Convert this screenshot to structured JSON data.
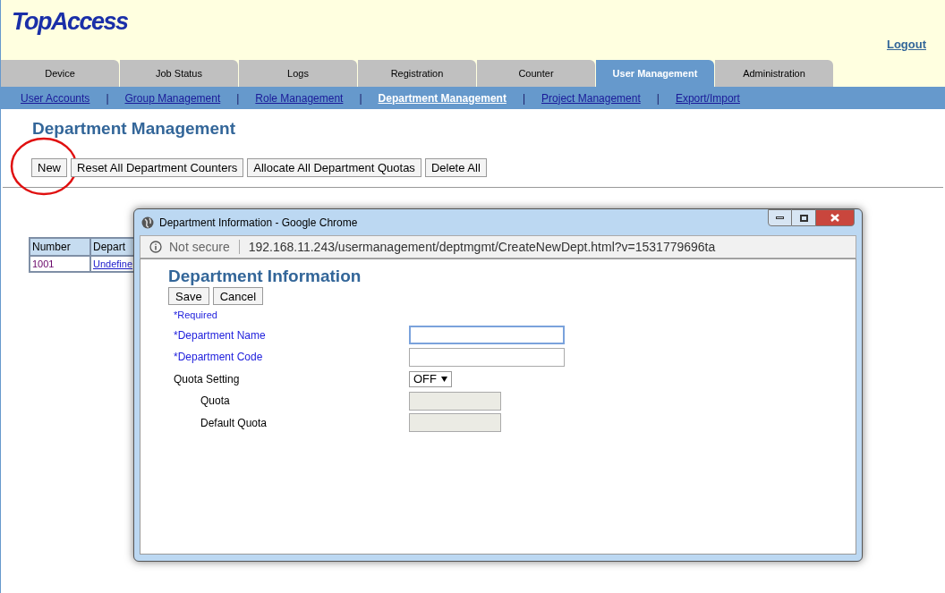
{
  "header": {
    "logo": "TopAccess",
    "logout": "Logout"
  },
  "tabs": [
    {
      "label": "Device",
      "selected": false
    },
    {
      "label": "Job Status",
      "selected": false
    },
    {
      "label": "Logs",
      "selected": false
    },
    {
      "label": "Registration",
      "selected": false
    },
    {
      "label": "Counter",
      "selected": false
    },
    {
      "label": "User Management",
      "selected": true
    },
    {
      "label": "Administration",
      "selected": false
    }
  ],
  "subnav": {
    "separator": "|",
    "items": [
      {
        "label": "User Accounts",
        "selected": false
      },
      {
        "label": "Group Management",
        "selected": false
      },
      {
        "label": "Role Management",
        "selected": false
      },
      {
        "label": "Department Management",
        "selected": true
      },
      {
        "label": "Project Management",
        "selected": false
      },
      {
        "label": "Export/Import",
        "selected": false
      }
    ]
  },
  "page": {
    "title": "Department Management",
    "buttons": [
      {
        "label": "New",
        "circled": true
      },
      {
        "label": "Reset All Department Counters",
        "circled": false
      },
      {
        "label": "Allocate All Department Quotas",
        "circled": false
      },
      {
        "label": "Delete All",
        "circled": false
      }
    ]
  },
  "table": {
    "columns": [
      "Number",
      "Depart"
    ],
    "rows": [
      [
        "1001",
        "Undefine"
      ]
    ]
  },
  "popup": {
    "title": "Department Information - Google Chrome",
    "security": "Not secure",
    "url": "192.168.11.243/usermanagement/deptmgmt/CreateNewDept.html?v=1531779696ta",
    "heading": "Department Information",
    "buttons": [
      "Save",
      "Cancel"
    ],
    "required_note": "*Required",
    "fields": [
      {
        "label": "*Department Name",
        "kind": "text",
        "required": true,
        "indented": false,
        "focused": true,
        "disabled": false
      },
      {
        "label": "*Department Code",
        "kind": "text",
        "required": true,
        "indented": false,
        "focused": false,
        "disabled": false
      },
      {
        "label": "Quota Setting",
        "kind": "select",
        "value": "OFF",
        "required": false,
        "indented": false
      },
      {
        "label": "Quota",
        "kind": "text",
        "required": false,
        "indented": true,
        "focused": false,
        "disabled": true
      },
      {
        "label": "Default Quota",
        "kind": "text",
        "required": false,
        "indented": true,
        "focused": false,
        "disabled": true
      }
    ]
  }
}
